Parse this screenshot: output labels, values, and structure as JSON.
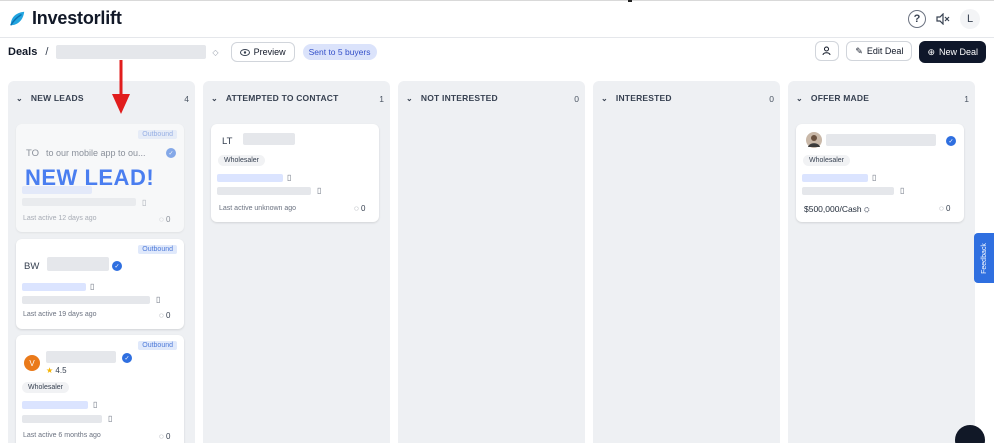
{
  "app": {
    "name": "Investorlift"
  },
  "topbar": {
    "help_icon": "question-circle-icon",
    "mute_icon": "speaker-mute-icon",
    "user_initial": "L"
  },
  "subbar": {
    "crumb": "Deals",
    "separator": "/",
    "preview_label": "Preview",
    "sent_badge": "Sent to 5 buyers",
    "edit_label": "Edit Deal",
    "new_deal_label": "New Deal"
  },
  "columns": [
    {
      "title": "NEW LEADS",
      "count": "4"
    },
    {
      "title": "ATTEMPTED TO CONTACT",
      "count": "1"
    },
    {
      "title": "NOT INTERESTED",
      "count": "0"
    },
    {
      "title": "INTERESTED",
      "count": "0"
    },
    {
      "title": "OFFER MADE",
      "count": "1"
    }
  ],
  "cards": {
    "c1": {
      "badge": "Outbound",
      "initials": "TO",
      "name": "to our mobile app to ou...",
      "overlay": "NEW LEAD!",
      "last_active": "Last active 12 days ago",
      "comments": "0"
    },
    "c2": {
      "badge": "Outbound",
      "initials": "BW",
      "last_active": "Last active 19 days ago",
      "comments": "0"
    },
    "c3": {
      "badge": "Outbound",
      "initials": "V",
      "rating": "4.5",
      "tag": "Wholesaler",
      "last_active": "Last active 6 months ago",
      "comments": "0"
    },
    "c4": {
      "initials": "LT",
      "tag": "Wholesaler",
      "last_active": "Last active unknown ago",
      "comments": "0"
    },
    "c5": {
      "tag": "Wholesaler",
      "price": "$500,000/Cash",
      "comments": "0"
    }
  },
  "feedback": {
    "label": "Feedback"
  },
  "colors": {
    "accent": "#2f6fe0",
    "dark": "#0f172a",
    "arrow": "#e11d1d",
    "orange": "#ea7a1a"
  }
}
